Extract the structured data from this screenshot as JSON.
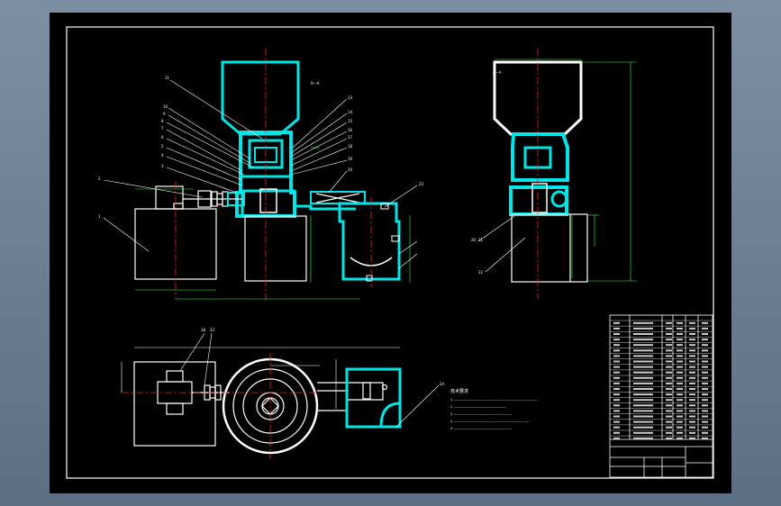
{
  "section_mark": "A—A",
  "section_mark_right": "A—A",
  "notes_title": "技术要求",
  "notes": [
    "1. —————————————————————————————",
    "2. ——————————————————",
    "3. ————————————————————",
    "4. ——————————————————————————",
    "5. ————————————————————"
  ],
  "balloons_front": [
    "11",
    "10",
    "9",
    "8",
    "7",
    "6",
    "5",
    "4",
    "3",
    "2",
    "1"
  ],
  "balloons_front_right": [
    "13",
    "14",
    "15",
    "16",
    "17",
    "18",
    "19",
    "20"
  ],
  "balloons_side": [
    "20",
    "21",
    "22",
    "23"
  ],
  "balloons_plan": [
    "18",
    "22",
    "24"
  ],
  "colors": {
    "background": "#000000",
    "outline": "#ffffff",
    "section": "#00e5e5",
    "dimension": "#33ff33",
    "centerline": "#ff2020"
  }
}
